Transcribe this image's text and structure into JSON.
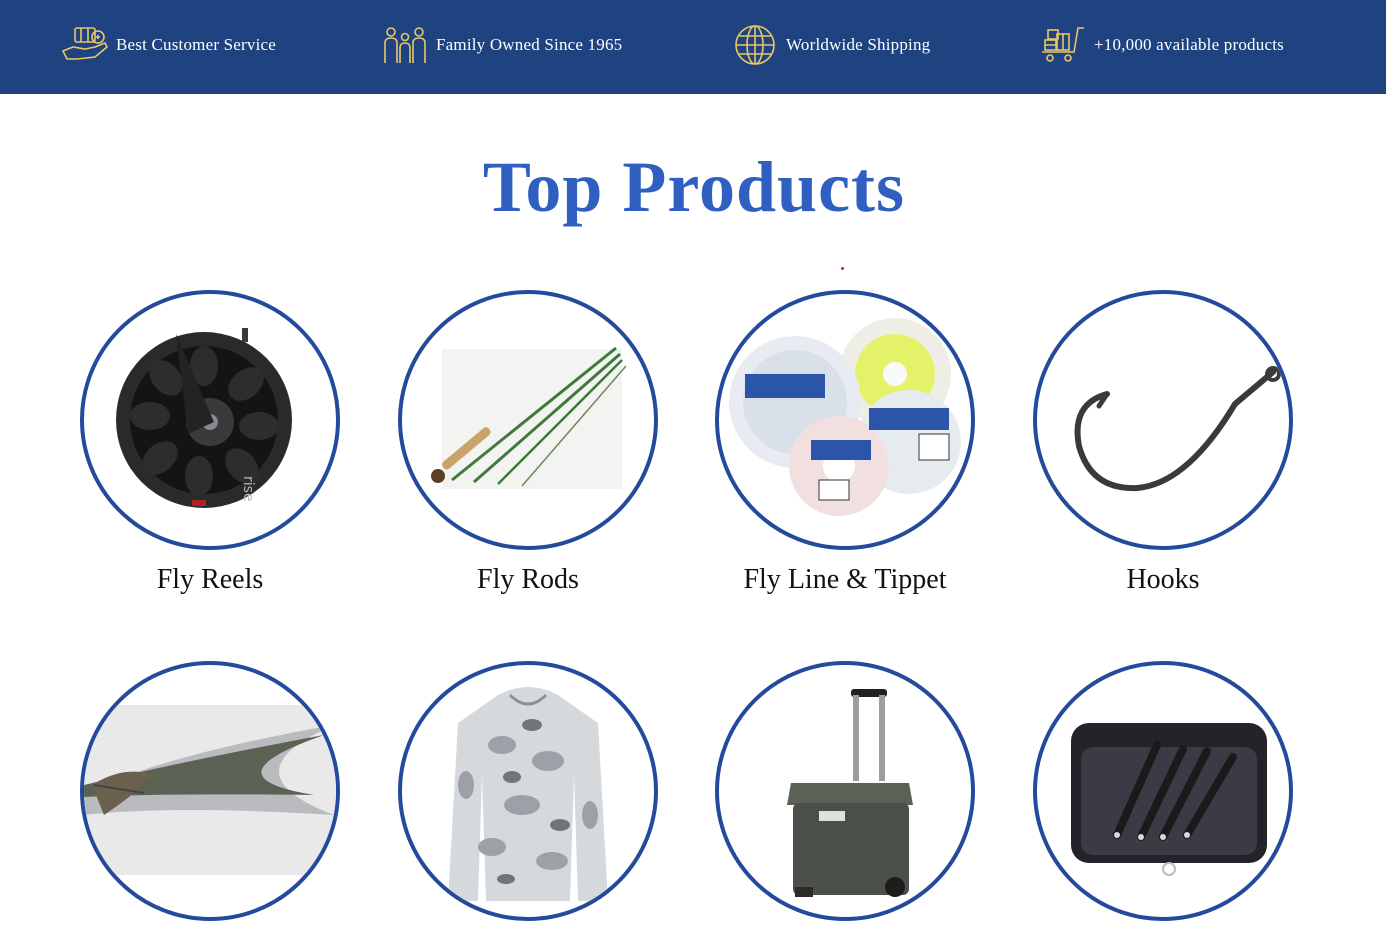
{
  "features": [
    {
      "label": "Best Customer Service",
      "icon": "hand-coins-icon"
    },
    {
      "label": "Family Owned Since 1965",
      "icon": "family-icon"
    },
    {
      "label": "Worldwide Shipping",
      "icon": "globe-icon"
    },
    {
      "label": "+10,000 available products",
      "icon": "cart-boxes-icon"
    }
  ],
  "section_title": "Top Products",
  "products": [
    {
      "label": "Fly Reels",
      "image": "fly-reel-image"
    },
    {
      "label": "Fly Rods",
      "image": "fly-rod-image"
    },
    {
      "label": "Fly Line & Tippet",
      "image": "fly-line-spools-image"
    },
    {
      "label": "Hooks",
      "image": "hook-image"
    },
    {
      "label": "",
      "image": "fly-lure-image"
    },
    {
      "label": "",
      "image": "camo-hoodie-image"
    },
    {
      "label": "",
      "image": "rolling-cooler-image"
    },
    {
      "label": "",
      "image": "pliers-case-image"
    }
  ],
  "colors": {
    "topbar": "#1f4280",
    "accent": "#2f5fc0",
    "ring": "#244b9b",
    "icon_gold": "#e8c766"
  }
}
